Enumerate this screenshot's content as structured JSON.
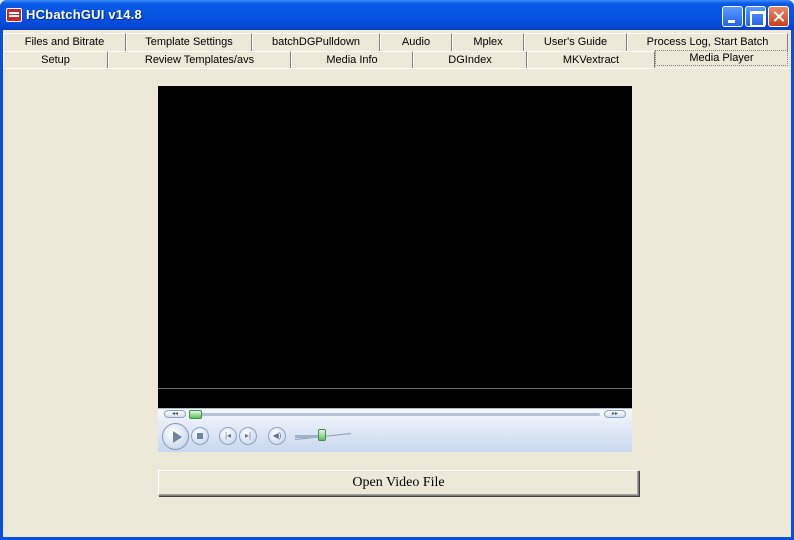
{
  "window": {
    "title": "HCbatchGUI v14.8"
  },
  "tabs": {
    "row1": [
      {
        "label": "Files and  Bitrate"
      },
      {
        "label": "Template Settings"
      },
      {
        "label": "batchDGPulldown"
      },
      {
        "label": "Audio"
      },
      {
        "label": "Mplex"
      },
      {
        "label": "User's Guide"
      },
      {
        "label": "Process Log, Start Batch"
      }
    ],
    "row2": [
      {
        "label": "Setup"
      },
      {
        "label": "Review Templates/avs"
      },
      {
        "label": "Media Info"
      },
      {
        "label": "DGIndex"
      },
      {
        "label": "MKVextract"
      },
      {
        "label": "Media Player",
        "active": true
      }
    ]
  },
  "media_player": {
    "open_button_label": "Open Video File",
    "seek_position": 0.02,
    "volume": 0.5,
    "rewind_glyph": "◂◂",
    "forward_glyph": "▸▸",
    "prev_glyph": "|◂",
    "next_glyph": "▸|",
    "mute_glyph": "◀)"
  }
}
